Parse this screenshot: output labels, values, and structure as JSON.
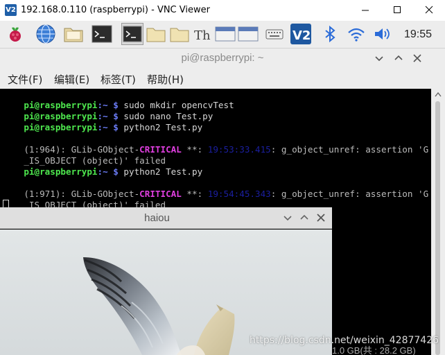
{
  "vnc": {
    "logo_text": "V2",
    "title": "192.168.0.110 (raspberrypi) - VNC Viewer"
  },
  "panel": {
    "icons": [
      "raspberry-menu",
      "web-browser",
      "file-manager",
      "terminal",
      "terminal-active",
      "folder",
      "folder",
      "thonny",
      "window",
      "window",
      "keyboard",
      "vnc-server",
      "bluetooth",
      "wifi",
      "volume"
    ],
    "clock": "19:55"
  },
  "terminal": {
    "title": "pi@raspberrypi: ~",
    "menus": [
      "文件(F)",
      "编辑(E)",
      "标签(T)",
      "帮助(H)"
    ],
    "prompt_user": "pi@raspberrypi",
    "prompt_path": ":~ $ ",
    "lines": [
      {
        "cmd": "sudo mkdir opencvTest"
      },
      {
        "cmd": "sudo nano Test.py"
      },
      {
        "cmd": "python2 Test.py"
      },
      {
        "pre": "(1:964): GLib-GObject-",
        "crit": "CRITICAL",
        "mid": " **: ",
        "time": "19:53:33.415",
        "post": ": g_object_unref: assertion 'G"
      },
      {
        "text": "_IS_OBJECT (object)' failed"
      },
      {
        "cmd": "python2 Test.py"
      },
      {
        "pre": "(1:971): GLib-GObject-",
        "crit": "CRITICAL",
        "mid": " **: ",
        "time": "19:54:45.343",
        "post": ": g_object_unref: assertion 'G"
      },
      {
        "text": "_IS_OBJECT (object)' failed"
      }
    ]
  },
  "image_window": {
    "title": "haiou"
  },
  "status_strip": "1.0 GB(共 : 28.2 GB)",
  "watermark": "https://blog.csdn.net/weixin_42877426",
  "colors": {
    "prompt_green": "#4ee74e",
    "prompt_blue": "#6b7cf6",
    "critical_magenta": "#e13fe1",
    "timestamp_blue": "#1b1fa0",
    "vnc_blue": "#1f5fa8",
    "panel_blue": "#2a6bd8"
  }
}
